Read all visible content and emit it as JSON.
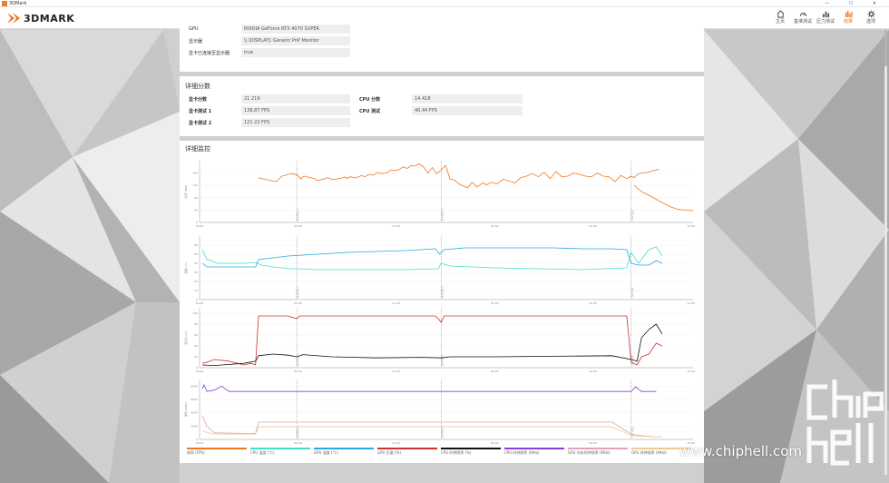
{
  "window": {
    "title": "3DMark"
  },
  "app": {
    "logo_text": "3DMARK"
  },
  "nav": [
    {
      "label": "主页",
      "icon": "home-icon",
      "active": false
    },
    {
      "label": "基准测试",
      "icon": "gauge-icon",
      "active": false
    },
    {
      "label": "压力测试",
      "icon": "bars-icon",
      "active": false
    },
    {
      "label": "结果",
      "icon": "results-icon",
      "active": true
    },
    {
      "label": "选项",
      "icon": "gear-icon",
      "active": false
    }
  ],
  "gpu_card": {
    "rows": [
      {
        "label": "GPU",
        "value": "NVIDIA GeForce RTX 4070 SUPER"
      },
      {
        "label": "显示器",
        "value": "\\\\.\\DISPLAY1 Generic PnP Monitor"
      },
      {
        "label": "显卡已连接至显示器",
        "value": "true"
      }
    ]
  },
  "score_card": {
    "title": "详细分数",
    "left": [
      {
        "label": "显卡分数",
        "value": "21 219"
      },
      {
        "label": "显卡测试 1",
        "value": "138.87 FPS"
      },
      {
        "label": "显卡测试 2",
        "value": "121.22 FPS"
      }
    ],
    "right": [
      {
        "label": "CPU 分数",
        "value": "14 418"
      },
      {
        "label": "CPU 测试",
        "value": "40.44 FPS"
      }
    ]
  },
  "monitor_card": {
    "title": "详细监控"
  },
  "chart_data": [
    {
      "type": "line",
      "ylabel": "帧率 (FPS)",
      "ylim": [
        0,
        200
      ],
      "yticks": [
        0,
        40,
        80,
        120,
        160
      ],
      "xticks": [
        "00:00",
        "00:40",
        "01:20",
        "02:00",
        "02:40",
        "03:20"
      ],
      "markers": [
        "显卡测试 1",
        "显卡测试 2",
        "CPU 测试"
      ],
      "series": [
        {
          "name": "帧率 (FPS)",
          "color": "#f07820",
          "x": [
            0.4,
            0.46,
            0.52,
            0.56,
            0.62,
            0.66,
            0.69,
            0.7,
            0.72,
            0.74,
            0.78,
            0.8,
            0.84,
            0.87,
            0.9,
            0.93,
            0.96,
            0.99,
            1.0,
            1.02,
            1.06,
            1.09,
            1.1,
            1.12,
            1.15,
            1.18,
            1.21,
            1.24,
            1.27,
            1.3,
            1.33,
            1.36,
            1.38,
            1.41,
            1.44,
            1.46,
            1.49,
            1.52,
            1.55,
            1.58,
            1.61,
            1.64,
            1.67,
            1.7,
            1.73,
            1.76,
            1.79,
            1.82,
            1.85,
            1.87,
            1.88,
            1.9,
            1.92,
            1.95,
            1.98,
            2.02,
            2.06,
            2.1,
            2.14,
            2.18,
            2.22,
            2.26,
            2.3,
            2.34,
            2.38,
            2.42,
            2.46,
            2.5,
            2.54,
            2.58,
            2.62,
            2.66,
            2.7,
            2.74,
            2.78,
            2.82,
            2.86,
            2.9,
            2.93,
            2.95,
            2.97,
            3.0,
            3.04,
            3.08,
            3.12
          ],
          "y": [
            145,
            138,
            132,
            150,
            158,
            155,
            140,
            148,
            150,
            146,
            142,
            136,
            140,
            145,
            139,
            141,
            143,
            147,
            142,
            148,
            144,
            150,
            152,
            148,
            155,
            153,
            162,
            158,
            160,
            170,
            168,
            172,
            180,
            175,
            185,
            182,
            190,
            180,
            160,
            178,
            158,
            170,
            185,
            140,
            138,
            125,
            118,
            112,
            130,
            122,
            115,
            120,
            128,
            122,
            130,
            125,
            140,
            135,
            128,
            145,
            150,
            158,
            148,
            162,
            142,
            165,
            148,
            150,
            160,
            155,
            150,
            148,
            160,
            150,
            148,
            132,
            152,
            142,
            150,
            145,
            155,
            160,
            162,
            168,
            172
          ]
        },
        {
          "name": "帧率 (FPS) CPU",
          "color": "#f07820",
          "x": [
            2.95,
            3.0,
            3.05,
            3.1,
            3.15,
            3.2,
            3.25,
            3.3,
            3.35
          ],
          "y": [
            120,
            100,
            88,
            75,
            62,
            50,
            42,
            40,
            38
          ]
        }
      ]
    }
  ],
  "legend": [
    {
      "label": "帧率 (FPS)",
      "color": "#f07820"
    },
    {
      "label": "CPU 温度 (°C)",
      "color": "#40e0c8"
    },
    {
      "label": "GPU 温度 (°C)",
      "color": "#2aa8e0"
    },
    {
      "label": "GPU 负载 (%)",
      "color": "#c83232"
    },
    {
      "label": "CPU 时钟频率 (%)",
      "color": "#111111"
    },
    {
      "label": "CPU 时钟频率 (MHz)",
      "color": "#8a3fd6"
    },
    {
      "label": "GPU 内存时钟频率 (MHz)",
      "color": "#e0a0c0"
    },
    {
      "label": "GPU 时钟频率 (MHz)",
      "color": "#f0c890"
    }
  ],
  "watermark": "www.chiphell.com"
}
